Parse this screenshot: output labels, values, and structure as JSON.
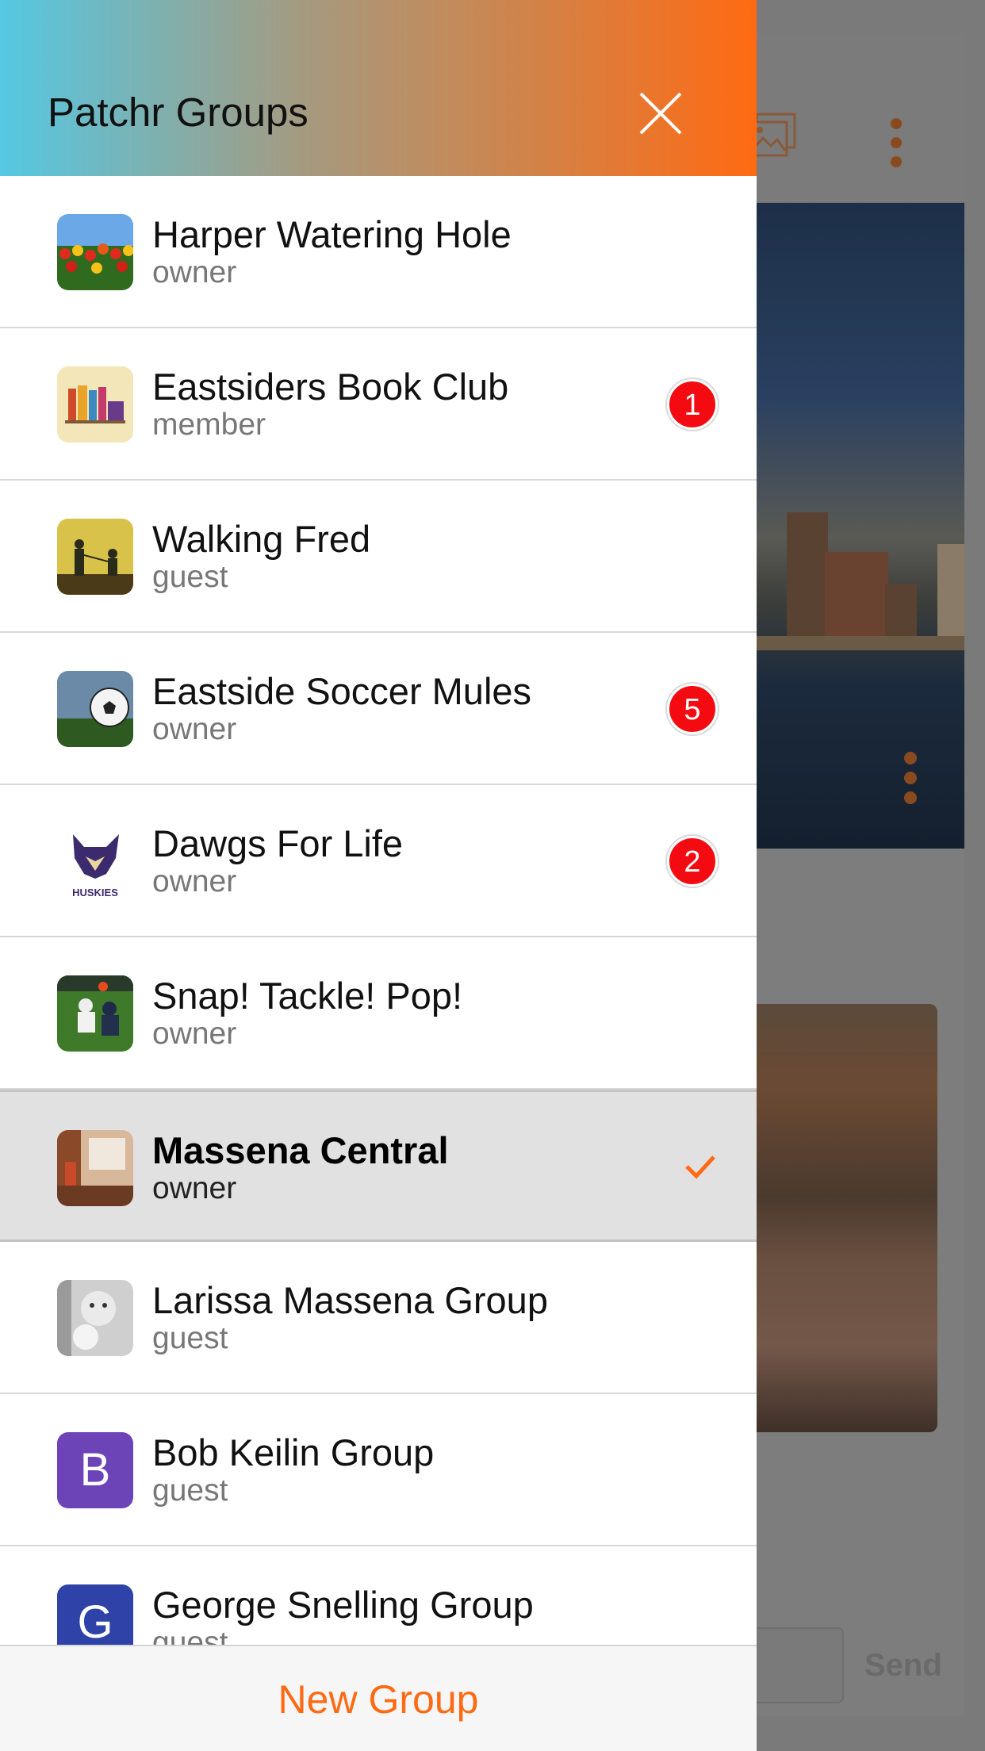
{
  "drawer": {
    "title": "Patchr Groups",
    "close_icon": "close-icon",
    "gradient_colors": [
      "#55c8e2",
      "#ff6a12"
    ]
  },
  "groups": [
    {
      "name": "Harper Watering Hole",
      "role": "owner",
      "badge": "",
      "selected": false,
      "avatar": "tulip-field-photo"
    },
    {
      "name": "Eastsiders Book Club",
      "role": "member",
      "badge": "1",
      "selected": false,
      "avatar": "book-club-logo"
    },
    {
      "name": "Walking Fred",
      "role": "guest",
      "badge": "",
      "selected": false,
      "avatar": "dog-walking-silhouette"
    },
    {
      "name": "Eastside Soccer Mules",
      "role": "owner",
      "badge": "5",
      "selected": false,
      "avatar": "soccer-ball-photo"
    },
    {
      "name": "Dawgs For Life",
      "role": "owner",
      "badge": "2",
      "selected": false,
      "avatar": "huskies-logo",
      "avatar_text": "HUSKIES"
    },
    {
      "name": "Snap! Tackle! Pop!",
      "role": "owner",
      "badge": "",
      "selected": false,
      "avatar": "football-photo"
    },
    {
      "name": "Massena Central",
      "role": "owner",
      "badge": "",
      "selected": true,
      "avatar": "interior-photo"
    },
    {
      "name": "Larissa Massena Group",
      "role": "guest",
      "badge": "",
      "selected": false,
      "avatar": "baby-photo"
    },
    {
      "name": "Bob Keilin Group",
      "role": "guest",
      "badge": "",
      "selected": false,
      "avatar_letter": "B",
      "avatar_color": "#6c44b8"
    },
    {
      "name": "George Snelling Group",
      "role": "guest",
      "badge": "",
      "selected": false,
      "avatar_letter": "G",
      "avatar_color": "#2e42a8"
    }
  ],
  "footer": {
    "new_group_label": "New Group",
    "accent": "#ff6a12"
  },
  "background_app": {
    "send_label": "Send"
  }
}
